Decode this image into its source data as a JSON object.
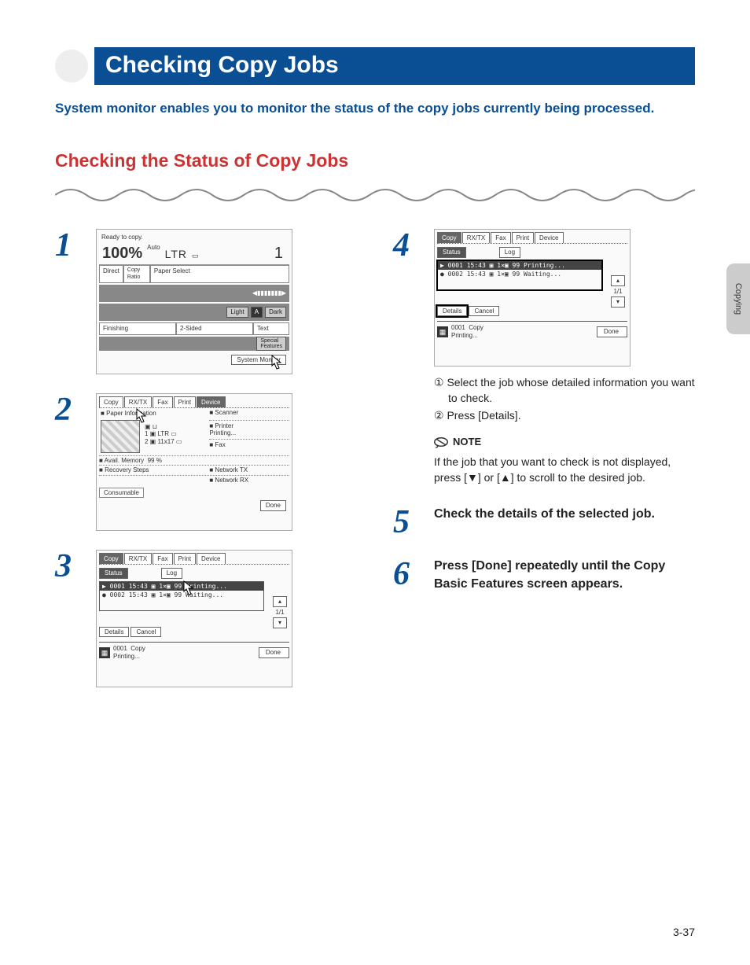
{
  "title": "Checking Copy Jobs",
  "intro": "System monitor enables you to monitor the status of the copy jobs currently being processed.",
  "section_heading": "Checking the Status of Copy Jobs",
  "side_tab": "Copying",
  "page_number": "3-37",
  "steps": {
    "s1": {
      "num": "1",
      "ready": "Ready to copy.",
      "ratio": "100%",
      "paper_auto": "Auto",
      "paper_size": "LTR",
      "count": "1",
      "direct": "Direct",
      "copy_ratio": "Copy\nRatio",
      "paper_select": "Paper Select",
      "light": "Light",
      "a": "A",
      "dark": "Dark",
      "finishing": "Finishing",
      "two_sided": "2-Sided",
      "text": "Text",
      "special": "Special\nFeatures",
      "system_monitor": "System Monitor"
    },
    "s2": {
      "num": "2",
      "tabs": [
        "Copy",
        "RX/TX",
        "Fax",
        "Print",
        "Device"
      ],
      "paper_info": "Paper Information",
      "p1": "1 ▣ LTR ▭",
      "p2": "2 ▣ 11x17 ▭",
      "scanner": "Scanner",
      "printer": "Printer",
      "printer_status": "Printing...",
      "fax": "Fax",
      "avail_memory": "Avail. Memory",
      "avail_memory_pct": "99 %",
      "recovery": "Recovery Steps",
      "net_tx": "Network TX",
      "net_rx": "Network RX",
      "consumable": "Consumable",
      "done": "Done"
    },
    "s3": {
      "num": "3",
      "tabs": [
        "Copy",
        "RX/TX",
        "Fax",
        "Print",
        "Device"
      ],
      "status": "Status",
      "log": "Log",
      "row1": "▶ 0001 15:43 ▣  1×▣ 99  Printing...",
      "row2": "● 0002 15:43 ▣  1×▣ 99  Waiting...",
      "pager": "1/1",
      "details": "Details",
      "cancel": "Cancel",
      "job_id": "0001",
      "job_type": "Copy",
      "job_state": "Printing...",
      "done": "Done"
    },
    "s4": {
      "num": "4",
      "tabs": [
        "Copy",
        "RX/TX",
        "Fax",
        "Print",
        "Device"
      ],
      "status": "Status",
      "log": "Log",
      "row1": "▶ 0001 15:43 ▣  1×▣ 99  Printing...",
      "row2": "● 0002 15:43 ▣  1×▣ 99  Waiting...",
      "pager": "1/1",
      "details": "Details",
      "cancel": "Cancel",
      "job_id": "0001",
      "job_type": "Copy",
      "job_state": "Printing...",
      "done": "Done",
      "sub1": "① Select the job whose detailed information you want to check.",
      "sub2": "② Press [Details].",
      "note_label": "NOTE",
      "note_text": "If the job that you want to check is not displayed, press [▼] or [▲] to scroll to the desired job."
    },
    "s5": {
      "num": "5",
      "text": "Check the details of the selected job."
    },
    "s6": {
      "num": "6",
      "text": "Press [Done] repeatedly until the Copy Basic Features screen appears."
    }
  }
}
